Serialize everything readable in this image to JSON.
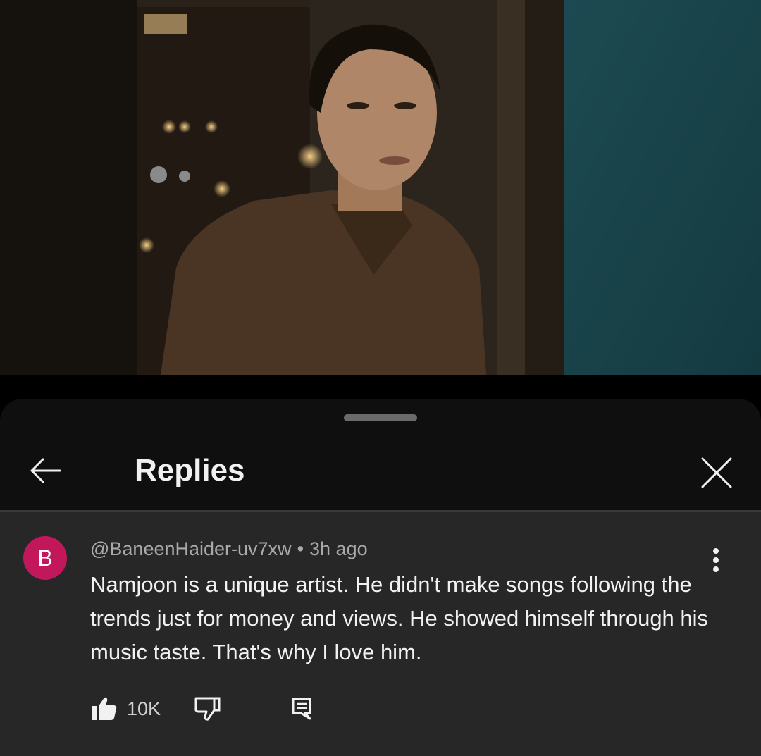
{
  "video": {
    "description_icon": "video-frame"
  },
  "sheet": {
    "title": "Replies",
    "back_icon": "arrow-left-icon",
    "close_icon": "close-icon"
  },
  "comment": {
    "avatar_letter": "B",
    "avatar_color": "#c2185b",
    "author": "@BaneenHaider-uv7xw",
    "separator": "•",
    "time": "3h ago",
    "text": "Namjoon is a unique artist. He didn't make songs following the trends just for money and views. He showed himself through his music taste. That's why I love him.",
    "like_count": "10K",
    "icons": {
      "like": "thumbs-up-icon",
      "dislike": "thumbs-down-icon",
      "reply": "reply-icon",
      "more": "more-vertical-icon"
    }
  }
}
